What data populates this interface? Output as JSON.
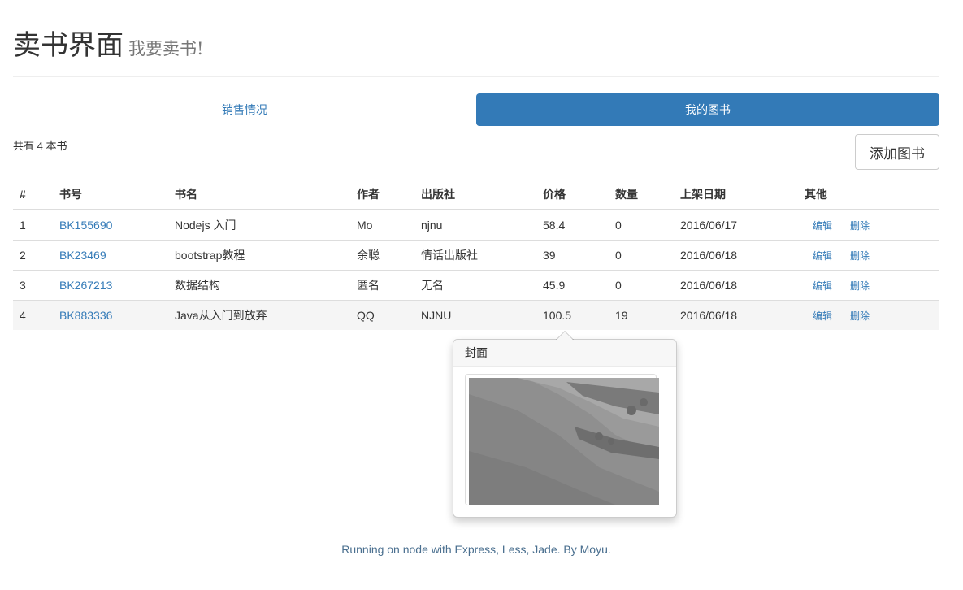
{
  "header": {
    "title": "卖书界面",
    "subtitle": "我要卖书!"
  },
  "tabs": [
    {
      "label": "销售情况",
      "active": false
    },
    {
      "label": "我的图书",
      "active": true
    }
  ],
  "toolbar": {
    "count_text": "共有 4 本书",
    "add_label": "添加图书"
  },
  "table": {
    "headers": [
      "#",
      "书号",
      "书名",
      "作者",
      "出版社",
      "价格",
      "数量",
      "上架日期",
      "其他"
    ],
    "rows": [
      {
        "num": "1",
        "isbn": "BK155690",
        "name": "Nodejs 入门",
        "author": "Mo",
        "publisher": "njnu",
        "price": "58.4",
        "qty": "0",
        "date": "2016/06/17"
      },
      {
        "num": "2",
        "isbn": "BK23469",
        "name": "bootstrap教程",
        "author": "余聪",
        "publisher": "情话出版社",
        "price": "39",
        "qty": "0",
        "date": "2016/06/18"
      },
      {
        "num": "3",
        "isbn": "BK267213",
        "name": "数据结构",
        "author": "匿名",
        "publisher": "无名",
        "price": "45.9",
        "qty": "0",
        "date": "2016/06/18"
      },
      {
        "num": "4",
        "isbn": "BK883336",
        "name": "Java从入门到放弃",
        "author": "QQ",
        "publisher": "NJNU",
        "price": "100.5",
        "qty": "19",
        "date": "2016/06/18"
      }
    ],
    "edit_label": "编辑",
    "delete_label": "删除"
  },
  "popover": {
    "title": "封面"
  },
  "footer": {
    "text": "Running on node with Express, Less, Jade. By Moyu."
  }
}
